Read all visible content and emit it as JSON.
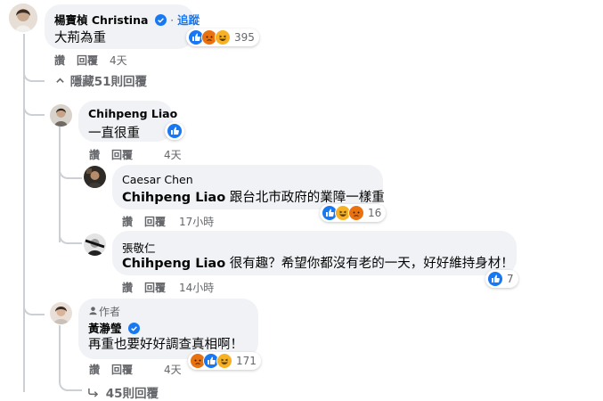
{
  "comments": [
    {
      "author": "楊寶楨 Christina",
      "action": "追蹤",
      "text": "大荊為重",
      "reactions": [
        "like-icon",
        "angry-icon",
        "haha-icon"
      ],
      "reaction_count": "395",
      "reply_label": "讚",
      "comment_label": "回覆",
      "time": "4天"
    },
    {
      "author": "Chihpeng Liao",
      "text": "一直很重",
      "reactions": [
        "like-icon"
      ],
      "reply_label": "讚",
      "comment_label": "回覆",
      "time": "4天"
    },
    {
      "author": "Caesar Chen",
      "mention": "Chihpeng Liao",
      "text": " 跟台北市政府的業障一樣重",
      "reactions": [
        "like-icon",
        "haha-icon",
        "angry-icon"
      ],
      "reaction_count": "16",
      "reply_label": "讚",
      "comment_label": "回覆",
      "time": "17小時"
    },
    {
      "author": "張敬仁",
      "mention": "Chihpeng Liao",
      "text": " 很有趣？希望你都沒有老的一天，好好維持身材！",
      "reactions": [
        "like-icon"
      ],
      "reaction_count": "7",
      "reply_label": "讚",
      "comment_label": "回覆",
      "time": "14小時"
    },
    {
      "author_tag": "作者",
      "author": "黃瀞瑩",
      "text": "再重也要好好調查真相啊！",
      "reactions": [
        "angry-icon",
        "like-icon",
        "haha-icon"
      ],
      "reaction_count": "171",
      "reply_label": "讚",
      "comment_label": "回覆",
      "time": "4天"
    }
  ],
  "hide_replies": "隱藏51則回覆",
  "more_replies": "45則回覆",
  "colors": {
    "bubble": "#f0f2f5",
    "text": "#050505",
    "secondary": "#65676b",
    "like_blue": "#1877f2",
    "angry_red": "#e9710f",
    "haha_yellow": "#f7b125",
    "thread_line": "#ccd0d5"
  }
}
